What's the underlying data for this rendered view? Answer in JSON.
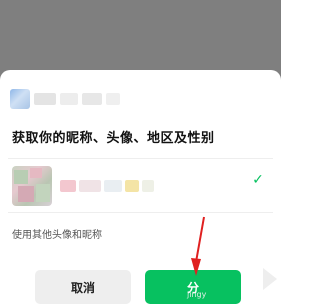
{
  "dialog": {
    "heading": "获取你的昵称、头像、地区及性别",
    "alt_link": "使用其他头像和昵称",
    "cancel_label": "取消",
    "share_label": "分",
    "watermark": "jingy"
  },
  "icons": {
    "app_icon": "mini-program-icon",
    "check": "check-icon"
  },
  "colors": {
    "accent": "#07c160",
    "overlay": "#7f7f7f",
    "annotation": "#e02020"
  }
}
